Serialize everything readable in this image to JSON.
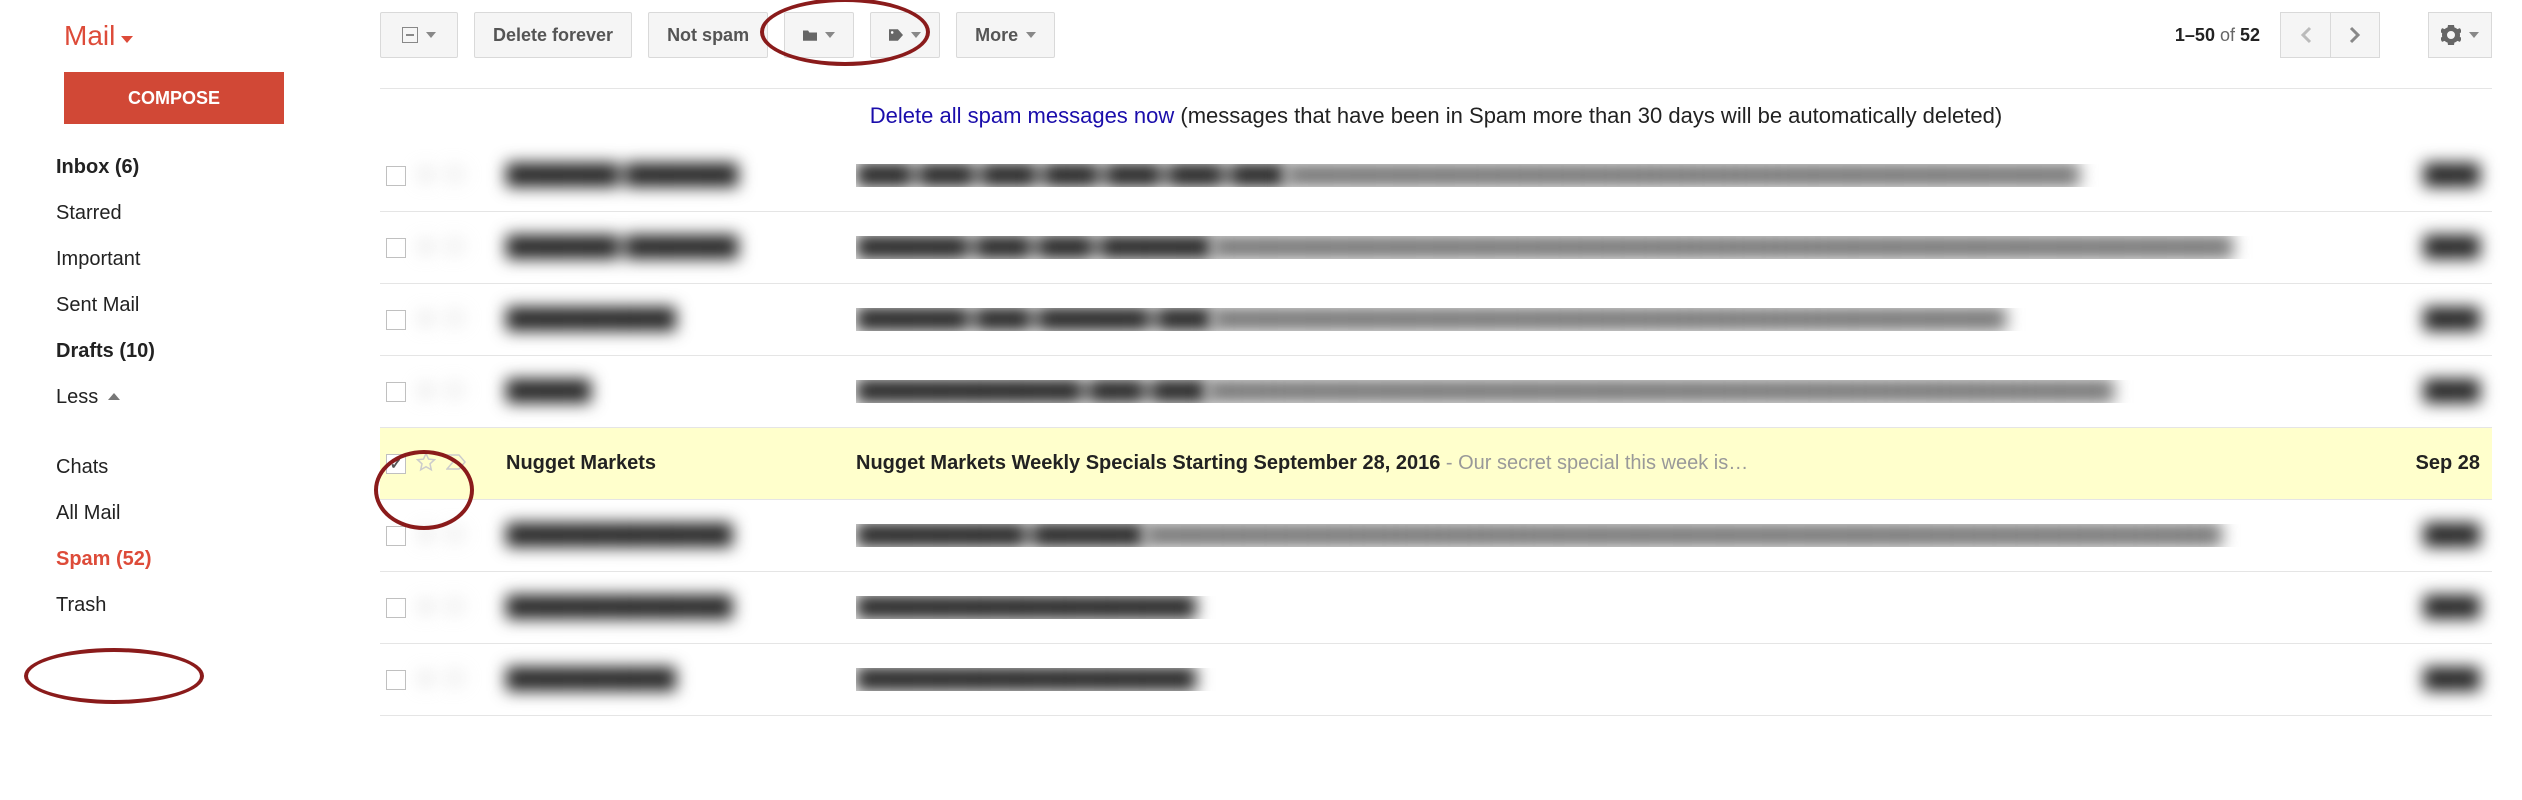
{
  "header": {
    "app_label": "Mail"
  },
  "compose_label": "COMPOSE",
  "nav": {
    "inbox": "Inbox (6)",
    "starred": "Starred",
    "important": "Important",
    "sent": "Sent Mail",
    "drafts": "Drafts (10)",
    "less": "Less",
    "chats": "Chats",
    "allmail": "All Mail",
    "spam": "Spam (52)",
    "trash": "Trash"
  },
  "toolbar": {
    "delete_forever": "Delete forever",
    "not_spam": "Not spam",
    "more": "More"
  },
  "pagination": {
    "range": "1–50",
    "of_word": " of ",
    "total": "52"
  },
  "banner": {
    "link": "Delete all spam messages now",
    "rest": " (messages that have been in Spam more than 30 days will be automatically deleted)"
  },
  "rows": [
    {
      "selected": false,
      "blurred": true,
      "sender": "████████ ████████",
      "subject": "████ ████ ████ ████ ████ ████ ████",
      "snippet": "████████████████████████████████████████████████████████",
      "date": "████"
    },
    {
      "selected": false,
      "blurred": true,
      "sender": "████████ ████████",
      "subject": "████████ ████ ████ ████████",
      "snippet": "████████████████████████████████████████████████████████████████████████",
      "date": "████"
    },
    {
      "selected": false,
      "blurred": true,
      "sender": "████████████",
      "subject": "████████ ████ ████████ ████",
      "snippet": "████████████████████████████████████████████████████████",
      "date": "████"
    },
    {
      "selected": false,
      "blurred": true,
      "sender": "██████",
      "subject": "████████████████ ████ ████",
      "snippet": "████████████████████████████████████████████████████████████████",
      "date": "████"
    },
    {
      "selected": true,
      "blurred": false,
      "sender": "Nugget Markets",
      "subject": "Nugget Markets Weekly Specials Starting September 28, 2016",
      "snippet": " - Our secret special this week is…",
      "date": "Sep 28"
    },
    {
      "selected": false,
      "blurred": true,
      "sender": "████████████████",
      "subject": "████████████ ████████",
      "snippet": "████████████████████████████████████████████████████████████████████████████",
      "date": "████"
    },
    {
      "selected": false,
      "blurred": true,
      "sender": "████████████████",
      "subject": "████████████████████████",
      "snippet": "",
      "date": "████"
    },
    {
      "selected": false,
      "blurred": true,
      "sender": "████████████",
      "subject": "████████████████████████",
      "snippet": "",
      "date": "████"
    }
  ]
}
